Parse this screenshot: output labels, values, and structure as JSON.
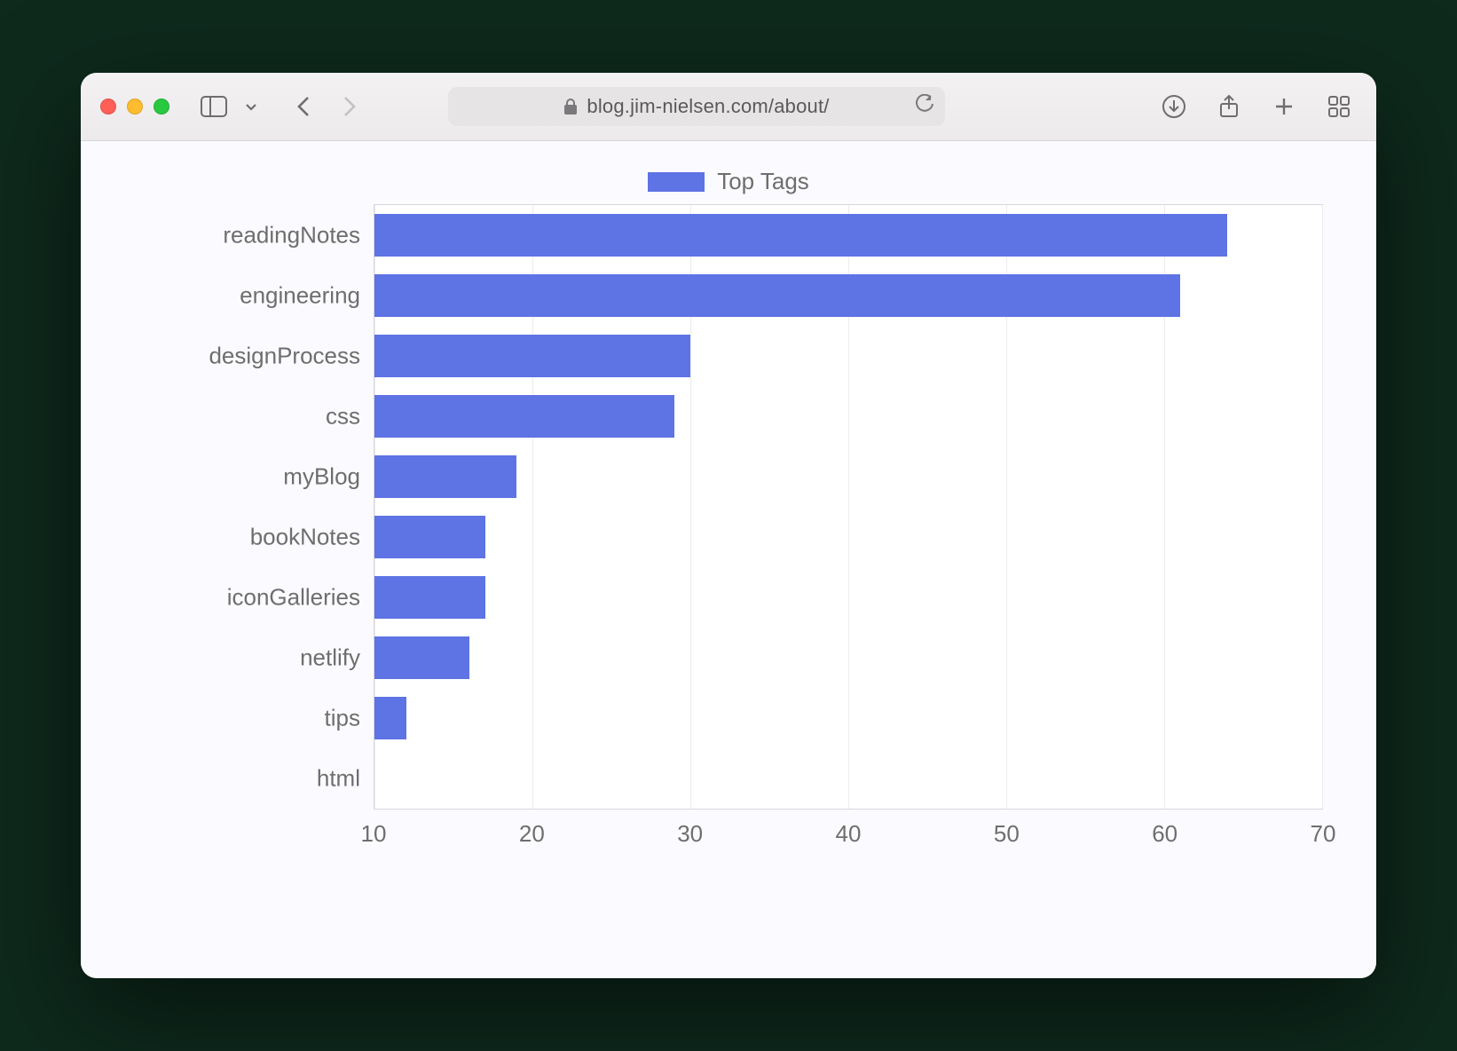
{
  "browser": {
    "url": "blog.jim-nielsen.com/about/"
  },
  "legend": {
    "label": "Top Tags"
  },
  "chart_data": {
    "type": "bar",
    "orientation": "horizontal",
    "title": "",
    "xlabel": "",
    "ylabel": "",
    "xlim": [
      10,
      70
    ],
    "xticks": [
      10,
      20,
      30,
      40,
      50,
      60,
      70
    ],
    "legend": [
      "Top Tags"
    ],
    "bar_color": "#5e73e4",
    "categories": [
      "readingNotes",
      "engineering",
      "designProcess",
      "css",
      "myBlog",
      "bookNotes",
      "iconGalleries",
      "netlify",
      "tips",
      "html"
    ],
    "values": [
      64,
      61,
      30,
      29,
      19,
      17,
      17,
      16,
      12,
      10
    ]
  }
}
